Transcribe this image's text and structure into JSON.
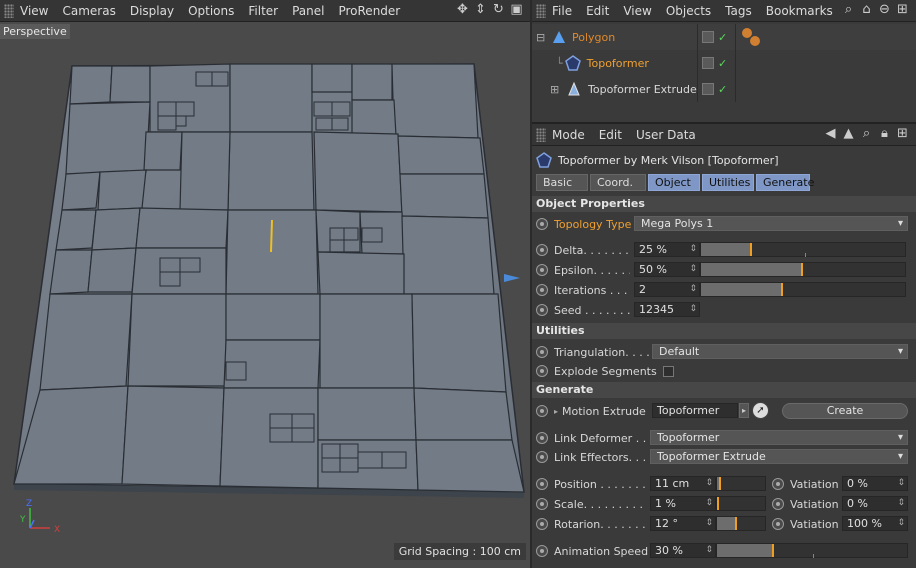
{
  "viewport": {
    "menu": [
      "View",
      "Cameras",
      "Display",
      "Options",
      "Filter",
      "Panel",
      "ProRender"
    ],
    "camera_label": "Perspective",
    "grid_spacing": "Grid Spacing : 100 cm",
    "axis": {
      "x": "X",
      "y": "Y",
      "z": "Z"
    }
  },
  "object_manager": {
    "menu": [
      "File",
      "Edit",
      "View",
      "Objects",
      "Tags",
      "Bookmarks"
    ],
    "objects": [
      {
        "name": "Polygon",
        "icon": "polygon-icon",
        "color": "#e0892a"
      },
      {
        "name": "Topoformer",
        "icon": "pentagon-icon",
        "color": "#f0a030"
      },
      {
        "name": "Topoformer Extrude",
        "icon": "extrude-icon",
        "color": "#d8d8d8"
      }
    ]
  },
  "attributes": {
    "menu": [
      "Mode",
      "Edit",
      "User Data"
    ],
    "title": "Topoformer by Merk Vilson [Topoformer]",
    "tabs": [
      "Basic",
      "Coord.",
      "Object",
      "Utilities",
      "Generate"
    ],
    "active_tabs": [
      "Object",
      "Utilities",
      "Generate"
    ],
    "section_object": "Object Properties",
    "topology_label": "Topology Type",
    "topology_value": "Mega Polys 1",
    "delta_label": "Delta. . . . . . .",
    "delta_value": "25 %",
    "delta_fill": 0.25,
    "epsilon_label": "Epsilon. . . . . .",
    "epsilon_value": "50 %",
    "epsilon_fill": 0.5,
    "iterations_label": "Iterations . . . .",
    "iterations_value": "2",
    "iterations_fill": 0.4,
    "seed_label": "Seed . . . . . . . .",
    "seed_value": "12345",
    "section_utilities": "Utilities",
    "triangulation_label": "Triangulation. . . .",
    "triangulation_value": "Default",
    "explode_label": "Explode Segments",
    "section_generate": "Generate",
    "motion_label": "Motion Extrude",
    "motion_value": "Topoformer",
    "create_label": "Create",
    "link_deformer_label": "Link Deformer . . .",
    "link_deformer_value": "Topoformer",
    "link_effectors_label": "Link Effectors. . . .",
    "link_effectors_value": "Topoformer Extrude",
    "position_label": "Position . . . . . . . .",
    "position_value": "11 cm",
    "scale_label": "Scale. . . . . . . . .",
    "scale_value": "1 %",
    "rotation_label": "Rotarion. . . . . . .",
    "rotation_value": "12 °",
    "variation_label": "Vatiation",
    "pos_variation": "0 %",
    "scale_variation": "0 %",
    "rot_variation": "100 %",
    "anim_speed_label": "Animation Speed",
    "anim_speed_value": "30 %",
    "anim_speed_fill": 0.3
  }
}
